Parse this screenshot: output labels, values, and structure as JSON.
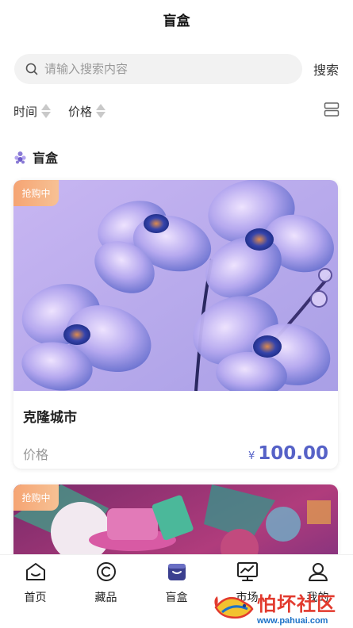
{
  "header": {
    "title": "盲盒"
  },
  "search": {
    "placeholder": "请输入搜索内容",
    "value": "",
    "button_label": "搜索"
  },
  "filters": [
    {
      "label": "时间"
    },
    {
      "label": "价格"
    }
  ],
  "section": {
    "title": "盲盒"
  },
  "cards": [
    {
      "badge": "抢购中",
      "name": "克隆城市",
      "price_label": "价格",
      "currency": "¥",
      "price": "100.00"
    },
    {
      "badge": "抢购中"
    }
  ],
  "tabbar": {
    "items": [
      {
        "label": "首页",
        "icon": "home-icon"
      },
      {
        "label": "藏品",
        "icon": "copyright-icon"
      },
      {
        "label": "盲盒",
        "icon": "box-icon",
        "active": true
      },
      {
        "label": "市场",
        "icon": "market-chart-icon"
      },
      {
        "label": "我的",
        "icon": "user-icon"
      }
    ]
  },
  "watermark": {
    "text": "怕坏社区",
    "url": "www.pahuai.com"
  },
  "colors": {
    "accent": "#5662c7",
    "badge": "#f5a473",
    "active_tab": "#3b3f8f"
  }
}
